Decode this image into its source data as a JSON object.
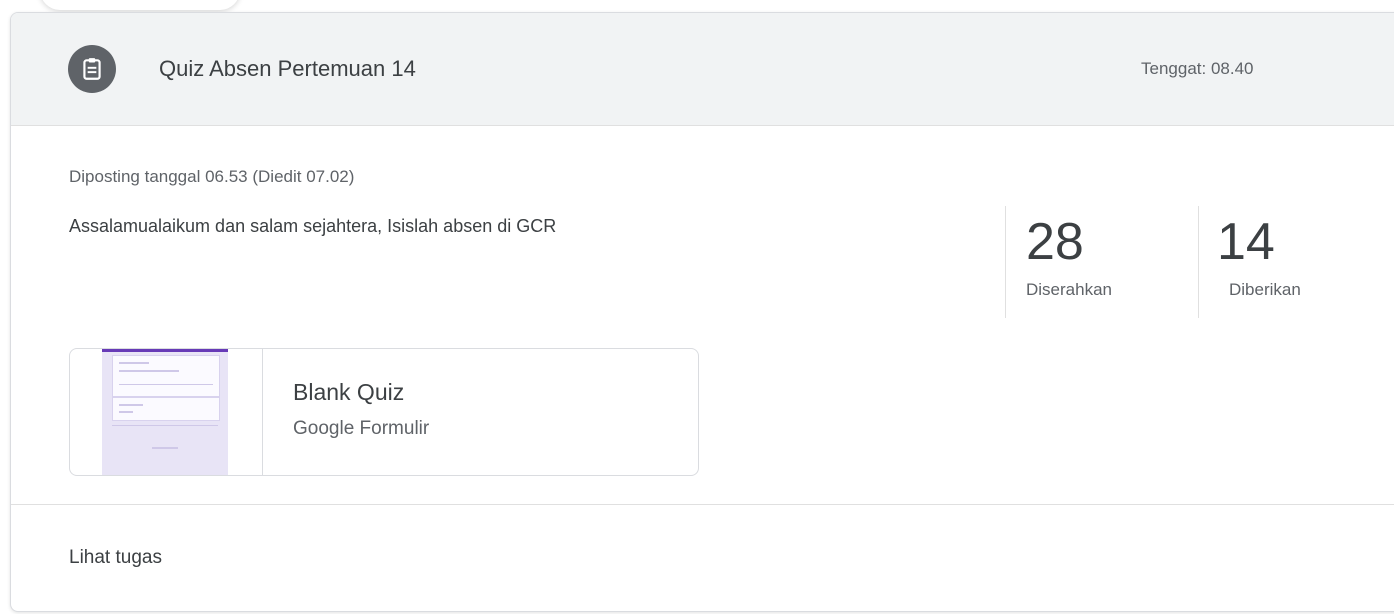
{
  "assignment": {
    "icon": "assignment-icon",
    "title": "Quiz Absen Pertemuan 14",
    "due": "Tenggat: 08.40",
    "posted": "Diposting tanggal 06.53 (Diedit 07.02)",
    "description": "Assalamualaikum dan salam sejahtera, Isislah absen di  GCR"
  },
  "stats": [
    {
      "value": "28",
      "label": "Diserahkan"
    },
    {
      "value": "14",
      "label": "Diberikan"
    }
  ],
  "attachment": {
    "title": "Blank Quiz",
    "type": "Google Formulir",
    "thumbnail_icon": "google-forms-thumbnail"
  },
  "footer": {
    "view_label": "Lihat tugas"
  }
}
